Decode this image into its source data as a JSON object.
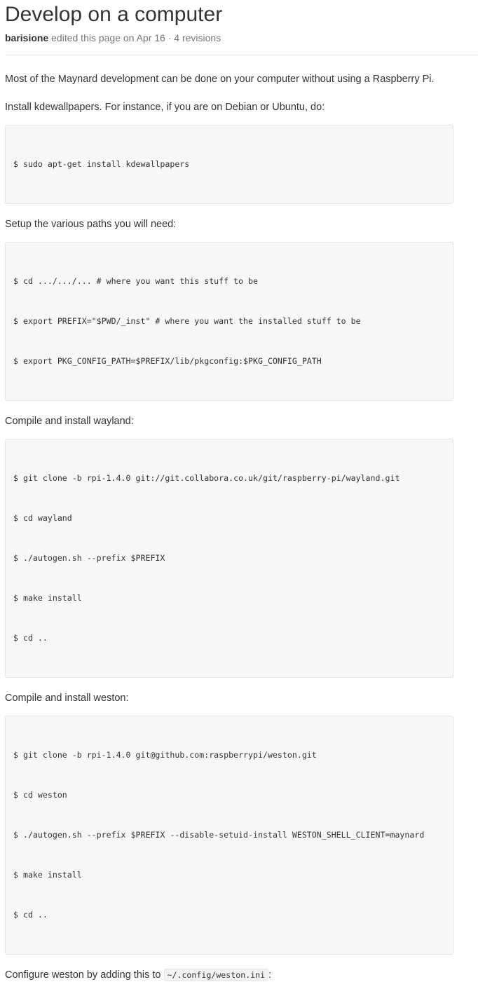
{
  "page": {
    "title": "Develop on a computer",
    "author": "barisione",
    "edit_text": "edited this page on Apr 16",
    "separator": "·",
    "revisions": "4 revisions"
  },
  "content": {
    "intro": "Most of the Maynard development can be done on your computer without using a Raspberry Pi.",
    "install_kde": "Install kdewallpapers. For instance, if you are on Debian or Ubuntu, do:",
    "code_kde": [
      "$ sudo apt-get install kdewallpapers"
    ],
    "setup_paths": "Setup the various paths you will need:",
    "code_paths": [
      "$ cd .../.../... # where you want this stuff to be",
      "$ export PREFIX=\"$PWD/_inst\" # where you want the installed stuff to be",
      "$ export PKG_CONFIG_PATH=$PREFIX/lib/pkgconfig:$PKG_CONFIG_PATH"
    ],
    "compile_wayland": "Compile and install wayland:",
    "code_wayland": [
      "$ git clone -b rpi-1.4.0 git://git.collabora.co.uk/git/raspberry-pi/wayland.git",
      "$ cd wayland",
      "$ ./autogen.sh --prefix $PREFIX",
      "$ make install",
      "$ cd .."
    ],
    "compile_weston": "Compile and install weston:",
    "code_weston": [
      "$ git clone -b rpi-1.4.0 git@github.com:raspberrypi/weston.git",
      "$ cd weston",
      "$ ./autogen.sh --prefix $PREFIX --disable-setuid-install WESTON_SHELL_CLIENT=maynard",
      "$ make install",
      "$ cd .."
    ],
    "configure_weston_prefix": "Configure weston by adding this to",
    "configure_weston_file": "~/.config/weston.ini",
    "configure_weston_suffix": ":"
  }
}
